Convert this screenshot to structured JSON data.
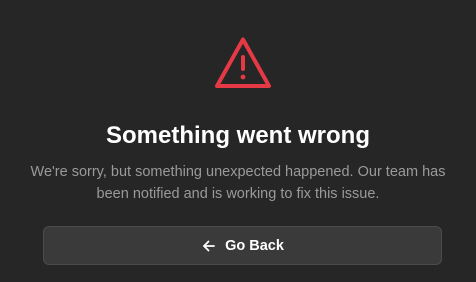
{
  "error": {
    "icon": "warning-triangle-icon",
    "title": "Something went wrong",
    "message": "We're sorry, but something unexpected happened. Our team has been notified and is working to fix this issue."
  },
  "actions": {
    "go_back_label": "Go Back",
    "go_back_icon": "arrow-left-icon"
  },
  "colors": {
    "background": "#262626",
    "accent_error": "#e63946",
    "title": "#ffffff",
    "message": "#9a9a9a",
    "button_background": "#3a3a3a",
    "button_border": "#4b4b4b"
  }
}
